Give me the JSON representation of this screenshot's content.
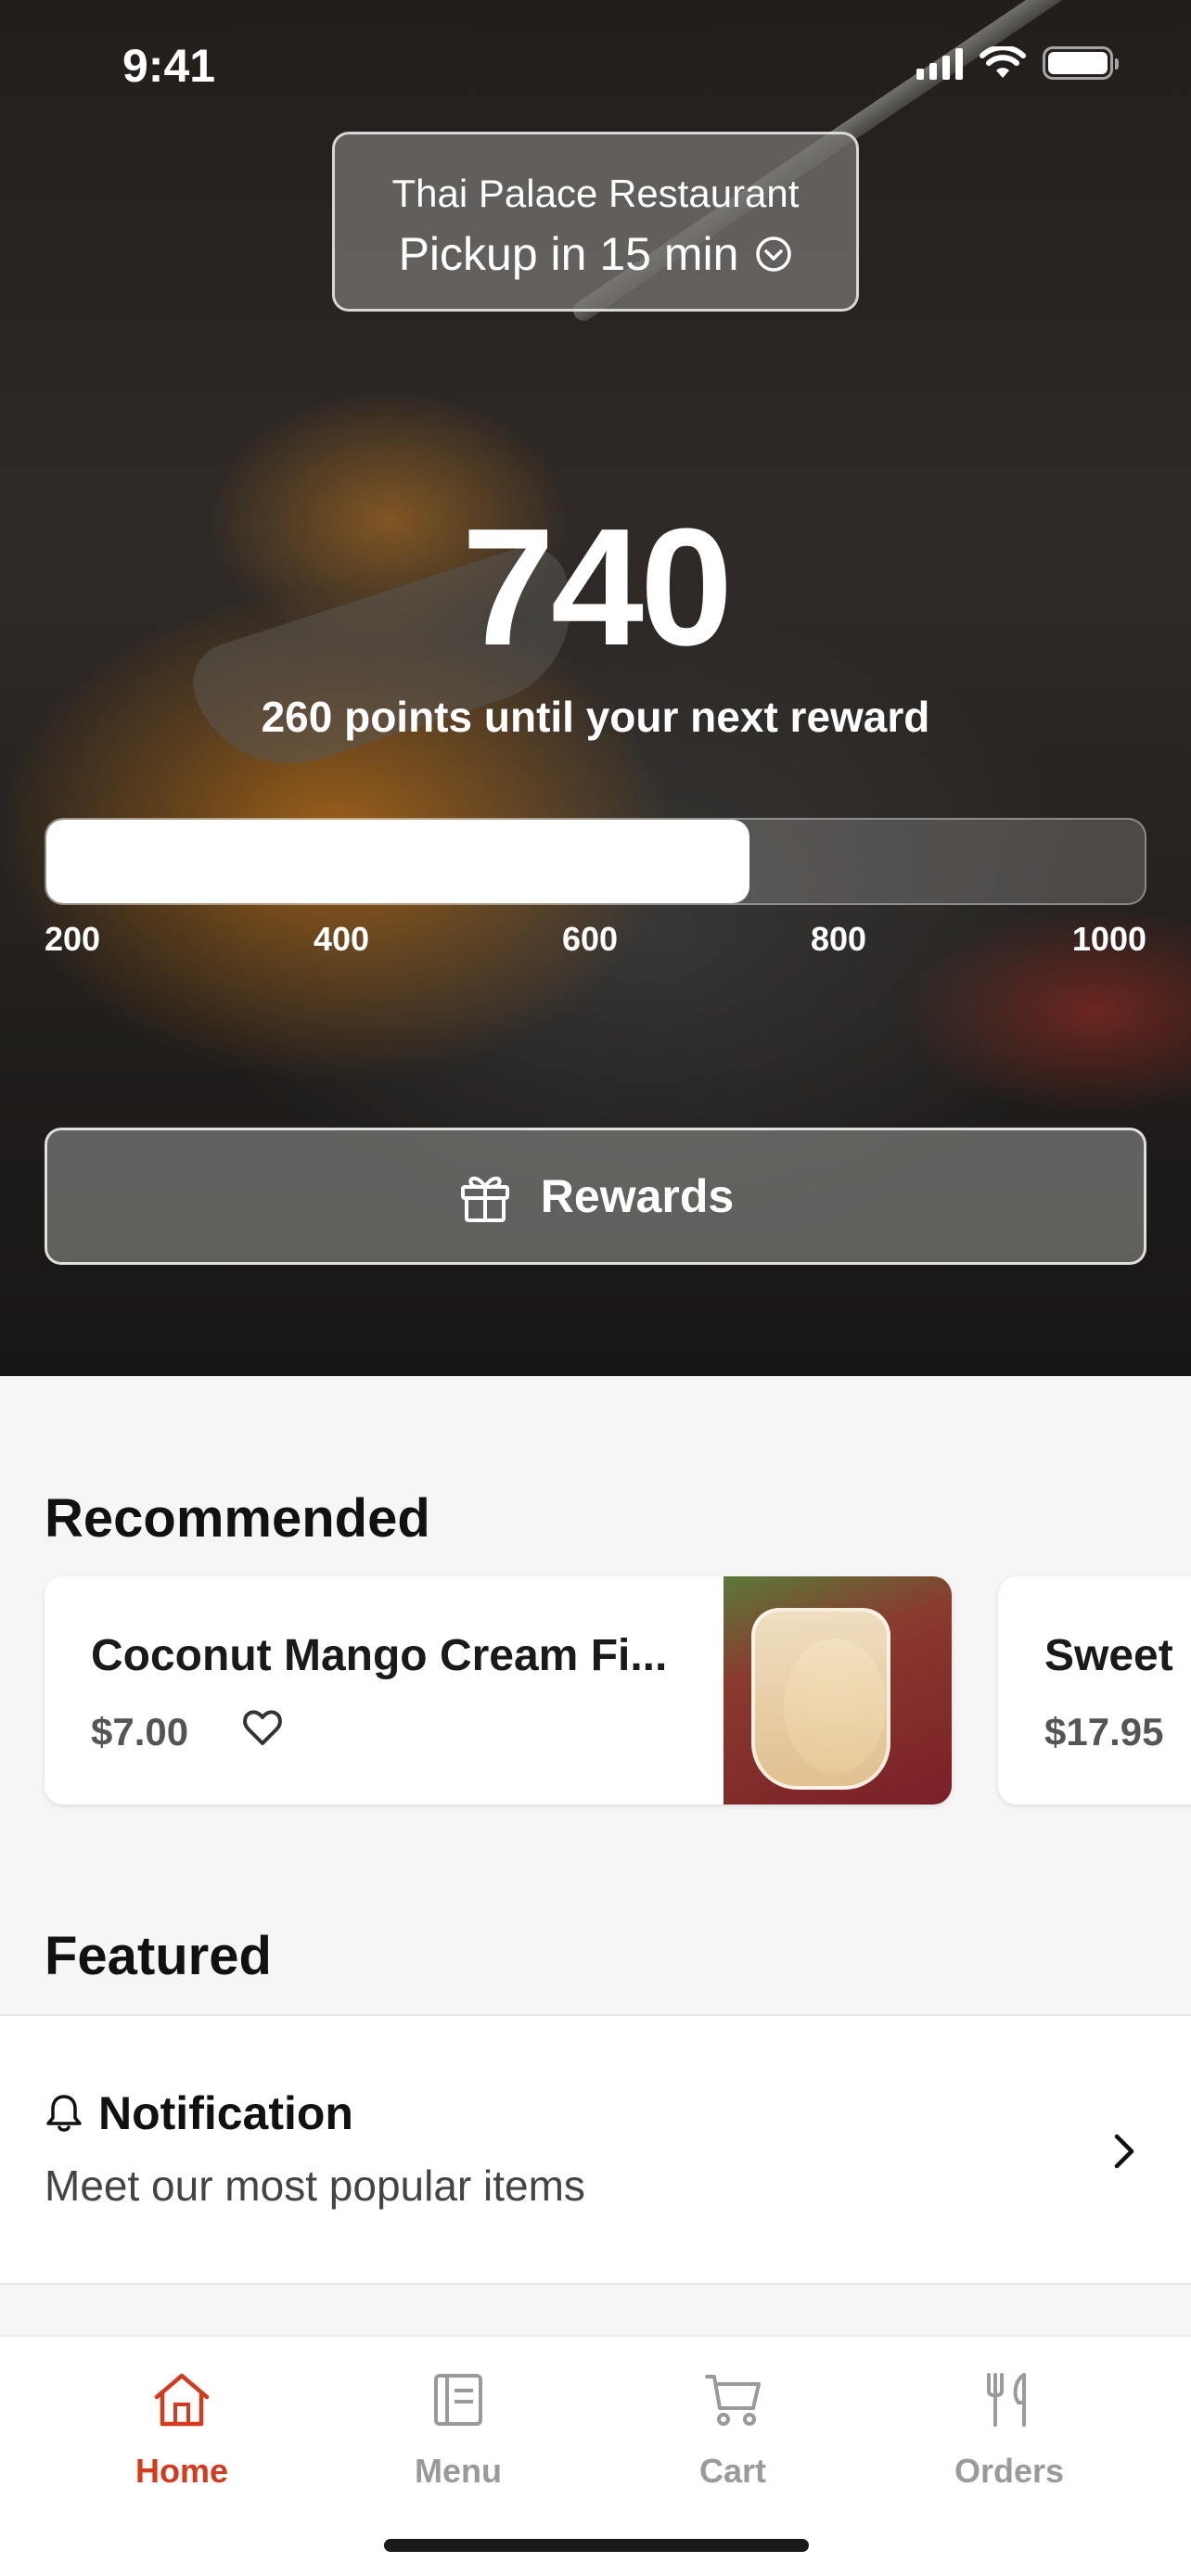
{
  "status_bar": {
    "time": "9:41"
  },
  "store": {
    "name": "Thai Palace Restaurant",
    "pickup": "Pickup in 15 min"
  },
  "rewards": {
    "points": "740",
    "until_next": "260 points until your next reward",
    "progress_fraction": 0.64,
    "ticks": [
      "200",
      "400",
      "600",
      "800",
      "1000"
    ],
    "button_label": "Rewards"
  },
  "recommended": {
    "title": "Recommended",
    "items": [
      {
        "name": "Coconut Mango Cream Fi...",
        "price": "$7.00"
      },
      {
        "name": "Sweet",
        "price": "$17.95"
      }
    ]
  },
  "featured": {
    "title": "Featured",
    "notification": {
      "title": "Notification",
      "subtitle": "Meet our most popular items"
    }
  },
  "tabs": [
    {
      "label": "Home",
      "icon": "home-icon",
      "active": true
    },
    {
      "label": "Menu",
      "icon": "menu-icon",
      "active": false
    },
    {
      "label": "Cart",
      "icon": "cart-icon",
      "active": false
    },
    {
      "label": "Orders",
      "icon": "orders-icon",
      "active": false
    }
  ],
  "colors": {
    "accent": "#d33a1e",
    "inactive_tab": "#9a9a9a"
  }
}
